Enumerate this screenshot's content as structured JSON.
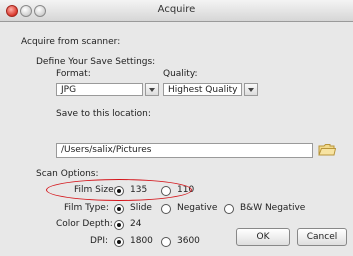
{
  "window": {
    "title": "Acquire"
  },
  "section_title": "Acquire from scanner:",
  "save_settings": {
    "heading": "Define Your Save Settings:",
    "format_label": "Format:",
    "format_value": "JPG",
    "quality_label": "Quality:",
    "quality_value": "Highest Quality",
    "save_location_label": "Save to this location:",
    "save_location_value": "/Users/salix/Pictures"
  },
  "scan_options": {
    "heading": "Scan Options:",
    "film_size": {
      "label": "Film Size:",
      "options": [
        "135",
        "110"
      ],
      "selected": "135"
    },
    "film_type": {
      "label": "Film Type:",
      "options": [
        "Slide",
        "Negative",
        "B&W Negative"
      ],
      "selected": "Slide"
    },
    "color_depth": {
      "label": "Color Depth:",
      "options": [
        "24"
      ],
      "selected": "24"
    },
    "dpi": {
      "label": "DPI:",
      "options": [
        "1800",
        "3600"
      ],
      "selected": "1800"
    }
  },
  "buttons": {
    "ok": "OK",
    "cancel": "Cancel"
  },
  "colors": {
    "highlight_ellipse": "#d4141a",
    "window_bg": "#e8e8e8"
  }
}
